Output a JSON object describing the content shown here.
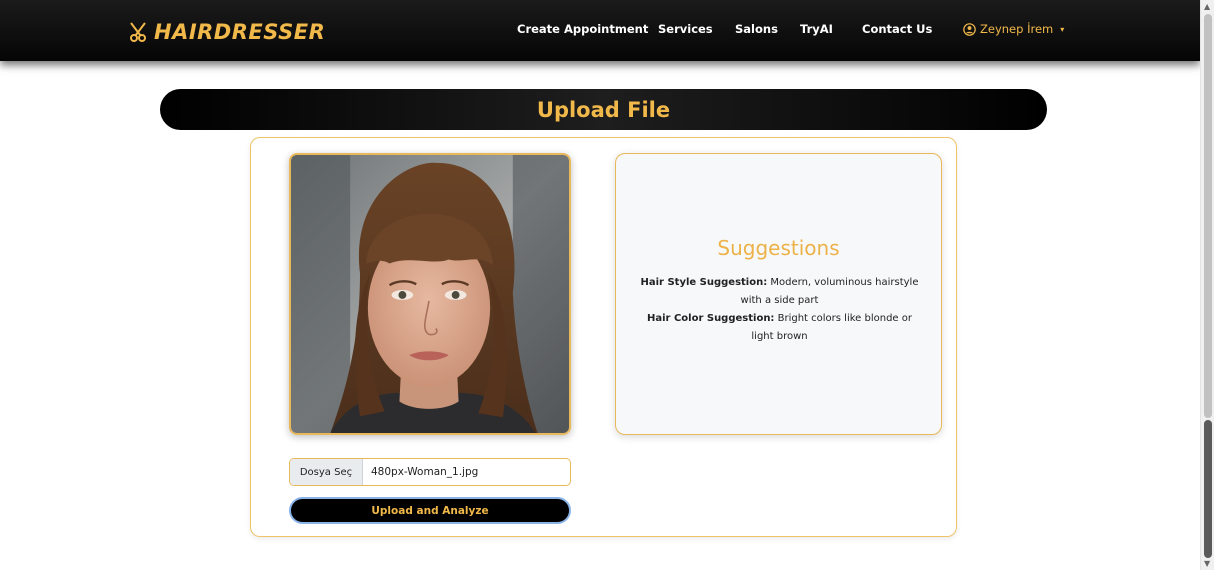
{
  "navbar": {
    "brand": "HAIRDRESSER",
    "brand_icon": "scissors-icon",
    "links": [
      {
        "label": "Create Appointment"
      },
      {
        "label": "Services"
      },
      {
        "label": "Salons"
      },
      {
        "label": "TryAI"
      },
      {
        "label": "Contact Us"
      }
    ],
    "user": {
      "name": "Zeynep İrem",
      "icon": "user-circle-icon",
      "caret": "▾"
    }
  },
  "upload": {
    "title": "Upload File"
  },
  "photo": {
    "icon": "woman-portrait-photo"
  },
  "suggestions": {
    "title": "Suggestions",
    "hair_style_label": "Hair Style Suggestion:",
    "hair_style_value": "Modern, voluminous hairstyle with a side part",
    "hair_color_label": "Hair Color Suggestion:",
    "hair_color_value": "Bright colors like blonde or light brown"
  },
  "file_input": {
    "button_label": "Dosya Seç",
    "file_name": "480px-Woman_1.jpg"
  },
  "analyze_button": {
    "label": "Upload and Analyze"
  },
  "colors": {
    "accent": "#f1b84a",
    "navbar_bg": "#111111",
    "card_border": "#eec46a"
  }
}
